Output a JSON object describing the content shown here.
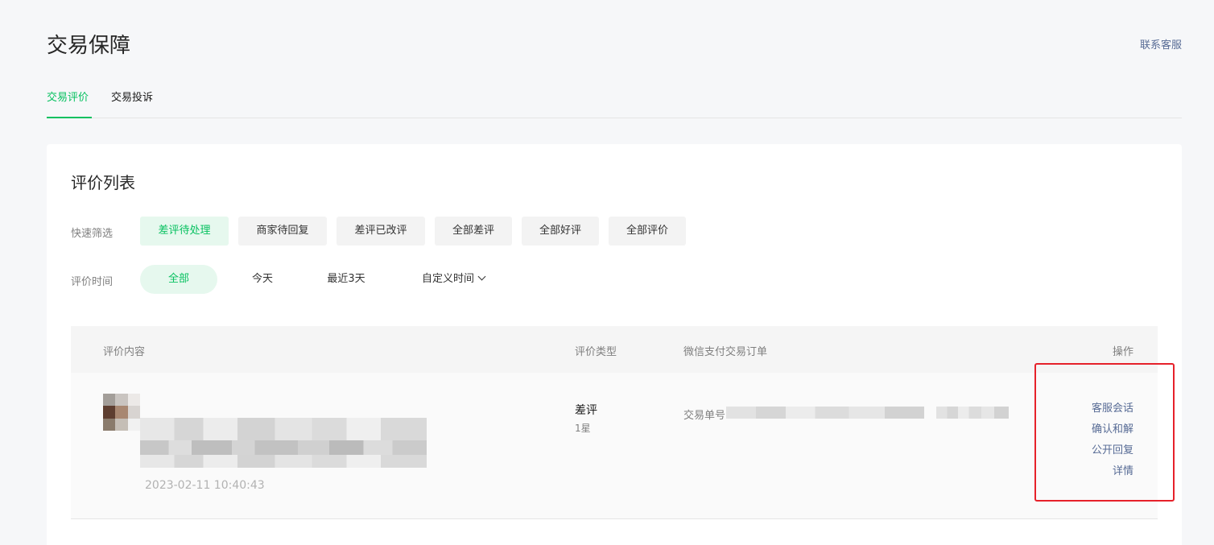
{
  "page": {
    "title": "交易保障",
    "contact_link": "联系客服"
  },
  "tabs": [
    {
      "label": "交易评价",
      "active": true
    },
    {
      "label": "交易投诉",
      "active": false
    }
  ],
  "card": {
    "title": "评价列表",
    "quick_filter": {
      "label": "快速筛选",
      "options": [
        "差评待处理",
        "商家待回复",
        "差评已改评",
        "全部差评",
        "全部好评",
        "全部评价"
      ],
      "selected": "差评待处理"
    },
    "time_filter": {
      "label": "评价时间",
      "options": [
        "全部",
        "今天",
        "最近3天",
        "自定义时间"
      ],
      "selected": "全部"
    }
  },
  "table": {
    "columns": [
      "评价内容",
      "评价类型",
      "微信支付交易订单",
      "操作"
    ],
    "rows": [
      {
        "review_time": "2023-02-11 10:40:43",
        "type": "差评",
        "stars": "1星",
        "order_label": "交易单号",
        "actions": [
          "客服会话",
          "确认和解",
          "公开回复",
          "详情"
        ]
      }
    ]
  },
  "colors": {
    "accent_green": "#07c160",
    "link_blue": "#576b95",
    "highlight_red": "#e6212a"
  }
}
